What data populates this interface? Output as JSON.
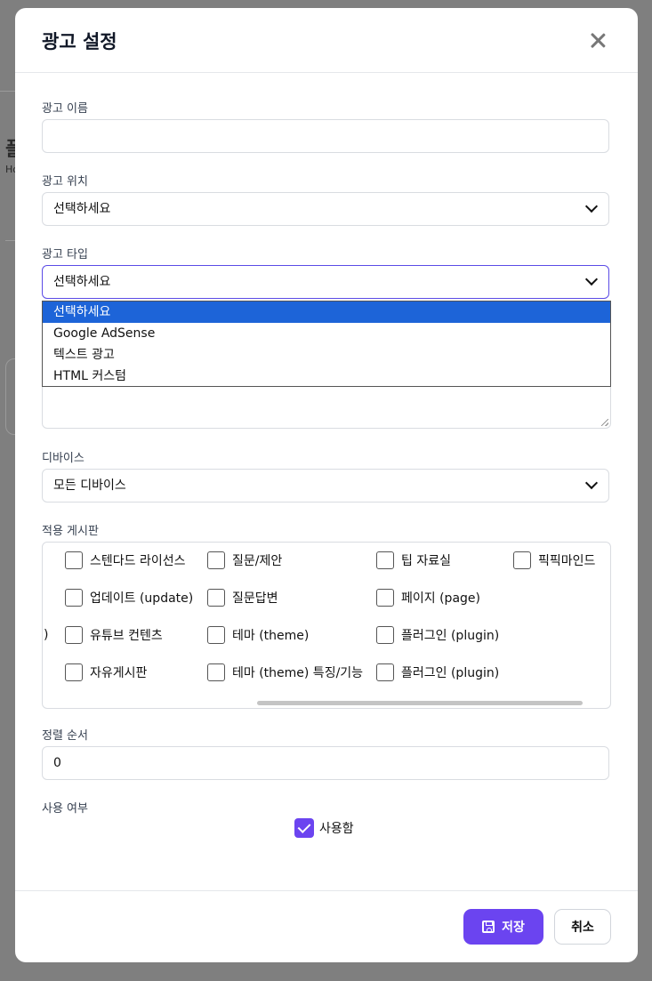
{
  "modal": {
    "title": "광고 설정"
  },
  "fields": {
    "ad_name": {
      "label": "광고 이름",
      "value": ""
    },
    "ad_position": {
      "label": "광고 위치",
      "value": "선택하세요"
    },
    "ad_type": {
      "label": "광고 타입",
      "value": "선택하세요",
      "options": [
        "선택하세요",
        "Google AdSense",
        "텍스트 광고",
        "HTML 커스텀"
      ]
    },
    "device": {
      "label": "디바이스",
      "value": "모든 디바이스"
    },
    "boards": {
      "label": "적용 게시판",
      "items": [
        "스텐다드 라이선스",
        "질문/제안",
        "팁 자료실",
        "픽픽마인드",
        "업데이트 (update)",
        "질문답변",
        "페이지 (page)",
        "유튜브 컨텐츠",
        "테마 (theme)",
        "플러그인 (plugin)",
        "자유게시판",
        "테마 (theme) 특징/기능",
        "플러그인 (plugin)"
      ],
      "clipped_fragment": ")"
    },
    "sort_order": {
      "label": "정렬 순서",
      "value": "0"
    },
    "use_status": {
      "label": "사용 여부",
      "checkbox_label": "사용함"
    }
  },
  "footer": {
    "save_label": "저장",
    "cancel_label": "취소"
  },
  "background": {
    "fragment_title": "플",
    "fragment_sub": "Ho"
  }
}
